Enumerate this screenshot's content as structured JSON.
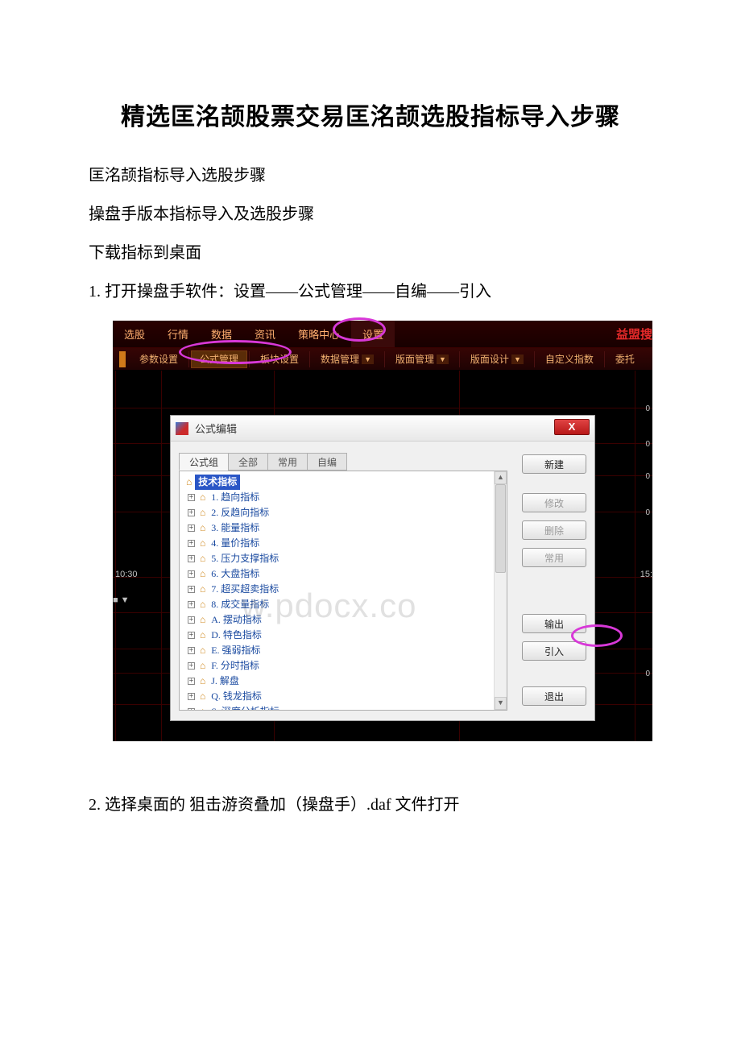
{
  "doc": {
    "title": "精选匡洺颉股票交易匡洺颉选股指标导入步骤",
    "p1": "匡洺颉指标导入选股步骤",
    "p2": "操盘手版本指标导入及选股步骤",
    "p3": "下载指标到桌面",
    "step1": "1. 打开操盘手软件：设置——公式管理——自编——引入",
    "step2": "2. 选择桌面的 狙击游资叠加（操盘手）.daf 文件打开"
  },
  "app": {
    "main_tabs": [
      "选股",
      "行情",
      "数据",
      "资讯",
      "策略中心",
      "设置"
    ],
    "brand": "益盟搜",
    "subnav": {
      "params": "参数设置",
      "formula": "公式管理",
      "block": "板块设置",
      "datamgr": "数据管理",
      "layoutmgr": "版面管理",
      "layoutdesign": "版面设计",
      "customidx": "自定义指数",
      "delegate": "委托"
    },
    "time_label": "10:30",
    "right_label": "15:",
    "tool_handle": "■"
  },
  "dialog": {
    "title": "公式编辑",
    "tabs": [
      "公式组",
      "全部",
      "常用",
      "自编"
    ],
    "tree_root": "技术指标",
    "items": [
      "1. 趋向指标",
      "2. 反趋向指标",
      "3. 能量指标",
      "4. 量价指标",
      "5. 压力支撑指标",
      "6. 大盘指标",
      "7. 超买超卖指标",
      "8. 成交量指标",
      "A. 摆动指标",
      "D. 特色指标",
      "E. 强弱指标",
      "F. 分时指标",
      "J. 解盘",
      "Q. 钱龙指标",
      "S. 深度分析指标"
    ],
    "buttons": {
      "new": "新建",
      "modify": "修改",
      "delete": "删除",
      "common": "常用",
      "export": "输出",
      "import": "引入",
      "exit": "退出"
    },
    "close": "X"
  },
  "watermark": "w.pdocx.co"
}
